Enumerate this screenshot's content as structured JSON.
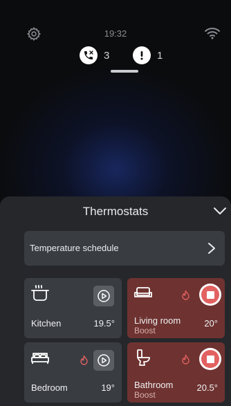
{
  "status": {
    "time": "19:32",
    "missed_calls_count": "3",
    "alerts_count": "1"
  },
  "sheet": {
    "title": "Thermostats",
    "schedule_label": "Temperature schedule"
  },
  "rooms": [
    {
      "name": "Kitchen",
      "temp": "19.5°",
      "sub": "",
      "icon": "cooking-pot-icon",
      "heating": false
    },
    {
      "name": "Living room",
      "temp": "20°",
      "sub": "Boost",
      "icon": "sofa-icon",
      "heating": true
    },
    {
      "name": "Bedroom",
      "temp": "19°",
      "sub": "",
      "icon": "bed-icon",
      "heating": true
    },
    {
      "name": "Bathroom",
      "temp": "20.5°",
      "sub": "Boost",
      "icon": "toilet-icon",
      "heating": true
    }
  ],
  "colors": {
    "background": "#0b0c0e",
    "glow": "#1a2b6b",
    "sheet": "#25272b",
    "tile_off": "#393c41",
    "tile_boost": "#6e3331",
    "flame": "#e26161",
    "stop_button": "#e26161"
  }
}
